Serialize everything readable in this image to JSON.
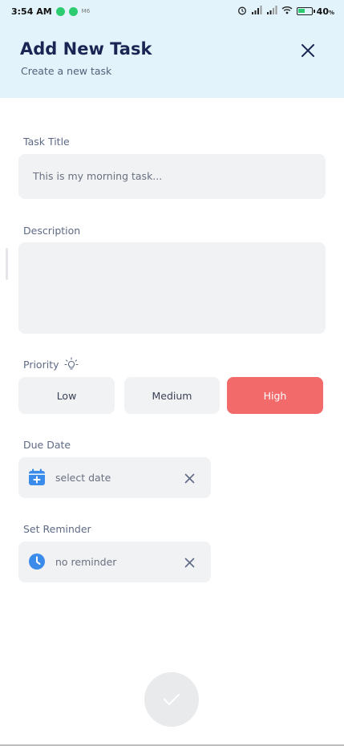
{
  "status_bar": {
    "time": "3:54 AM",
    "mini_label": "M6",
    "battery": "40",
    "battery_unit": "%",
    "icons": [
      "alarm-icon",
      "signal-icon",
      "signal-icon",
      "wifi-icon",
      "battery-icon"
    ]
  },
  "header": {
    "title": "Add New Task",
    "subtitle": "Create a new task",
    "close_icon": "close-icon"
  },
  "form": {
    "task_title": {
      "label": "Task Title",
      "placeholder": "This is my morning task..."
    },
    "description": {
      "label": "Description",
      "value": ""
    },
    "priority": {
      "label": "Priority",
      "icon": "lightbulb-icon",
      "options": [
        "Low",
        "Medium",
        "High"
      ],
      "selected": "High"
    },
    "due_date": {
      "label": "Due Date",
      "icon": "calendar-add-icon",
      "value": "select date"
    },
    "reminder": {
      "label": "Set Reminder",
      "icon": "clock-icon",
      "value": "no reminder"
    },
    "submit_icon": "check-icon"
  },
  "colors": {
    "header_bg": "#e3f3fb",
    "title": "#1b2553",
    "field_bg": "#f1f2f4",
    "high_priority": "#f26a6a",
    "icon_blue": "#3b8bea"
  }
}
